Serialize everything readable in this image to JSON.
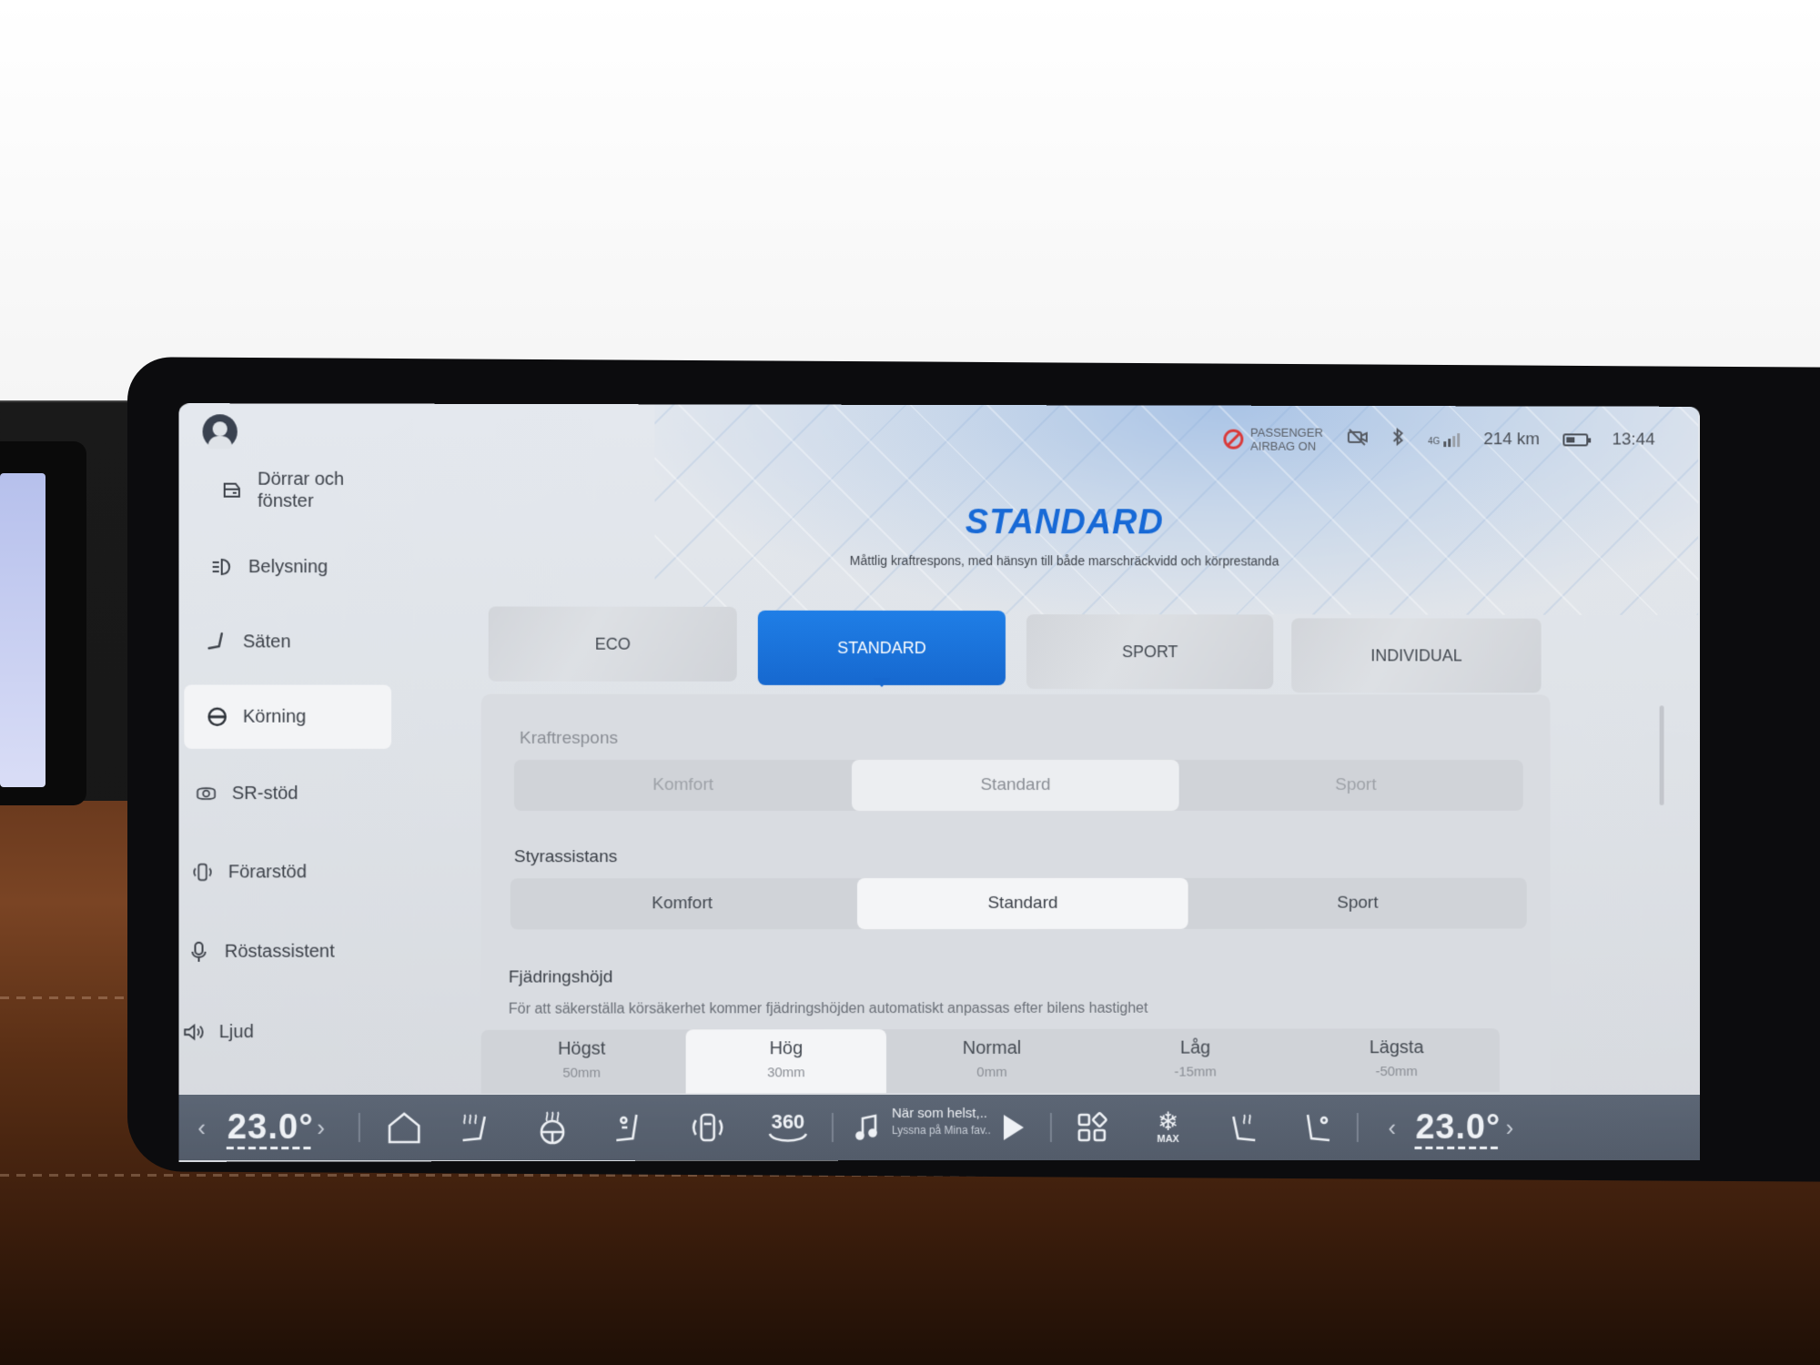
{
  "status": {
    "airbag_line1": "PASSENGER",
    "airbag_line2": "AIRBAG ON",
    "network": "4G",
    "range": "214 km",
    "time": "13:44"
  },
  "sidebar": {
    "items": [
      {
        "label": "Dörrar och fönster",
        "icon": "door-icon"
      },
      {
        "label": "Belysning",
        "icon": "headlight-icon"
      },
      {
        "label": "Säten",
        "icon": "seat-icon"
      },
      {
        "label": "Körning",
        "icon": "steering-wheel-icon",
        "active": true
      },
      {
        "label": "SR-stöd",
        "icon": "driver-assist-icon"
      },
      {
        "label": "Förarstöd",
        "icon": "car-assist-icon"
      },
      {
        "label": "Röstassistent",
        "icon": "microphone-icon"
      },
      {
        "label": "Ljud",
        "icon": "speaker-icon"
      }
    ]
  },
  "main": {
    "mode_title": "STANDARD",
    "mode_subtitle": "Måttlig kraftrespons, med hänsyn till både marschräckvidd och körprestanda",
    "modes": [
      "ECO",
      "STANDARD",
      "SPORT",
      "INDIVIDUAL"
    ],
    "selected_mode": "STANDARD",
    "power_response": {
      "label": "Kraftrespons",
      "options": [
        "Komfort",
        "Standard",
        "Sport"
      ],
      "selected": "Standard"
    },
    "steering_assist": {
      "label": "Styrassistans",
      "options": [
        "Komfort",
        "Standard",
        "Sport"
      ],
      "selected": "Standard"
    },
    "suspension": {
      "label": "Fjädringshöjd",
      "note": "För att säkerställa körsäkerhet kommer fjädringshöjden automatiskt anpassas efter bilens hastighet",
      "options": [
        {
          "name": "Högst",
          "value": "50mm"
        },
        {
          "name": "Hög",
          "value": "30mm"
        },
        {
          "name": "Normal",
          "value": "0mm"
        },
        {
          "name": "Låg",
          "value": "-15mm"
        },
        {
          "name": "Lägsta",
          "value": "-50mm"
        }
      ],
      "selected": "Hög"
    }
  },
  "dock": {
    "left_temp": "23.0°",
    "right_temp": "23.0°",
    "prev_arrow": "‹",
    "next_arrow": "›",
    "camera_label": "360",
    "max_label": "MAX",
    "media_title": "När som helst,..",
    "media_subtitle": "Lyssna på Mina fav.."
  },
  "colors": {
    "accent": "#1769d6",
    "active_tab": "#1f7ee6",
    "dock": "#59626f"
  }
}
